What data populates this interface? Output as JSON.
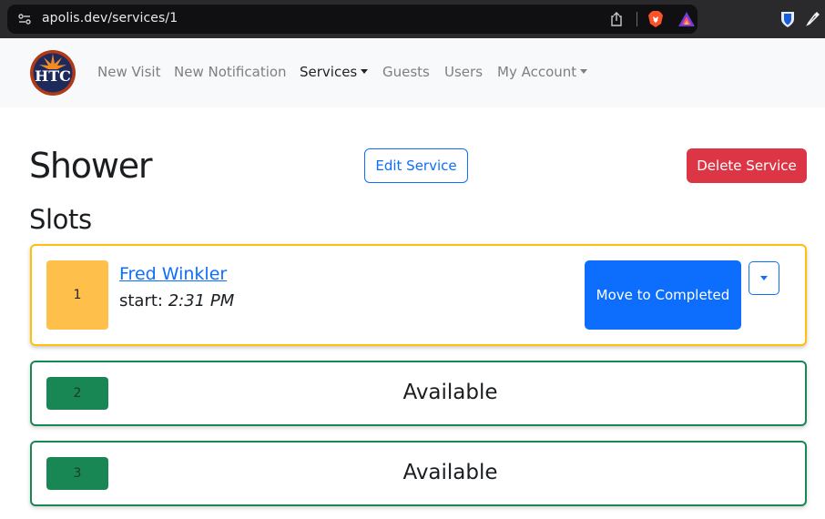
{
  "browser": {
    "url": "apolis.dev/services/1"
  },
  "nav": {
    "logo_text": "HTC",
    "items": [
      {
        "label": "New Visit",
        "has_dropdown": false,
        "active": false
      },
      {
        "label": "New Notification",
        "has_dropdown": false,
        "active": false
      },
      {
        "label": "Services",
        "has_dropdown": true,
        "active": true
      },
      {
        "label": "Guests",
        "has_dropdown": false,
        "active": false
      },
      {
        "label": "Users",
        "has_dropdown": false,
        "active": false
      },
      {
        "label": "My Account",
        "has_dropdown": true,
        "active": false
      }
    ]
  },
  "service": {
    "title": "Shower",
    "edit_label": "Edit Service",
    "delete_label": "Delete Service"
  },
  "slots_heading": "Slots",
  "slots": [
    {
      "number": "1",
      "status": "occupied",
      "guest_name": "Fred Winkler",
      "start_label": "start:",
      "start_time": "2:31 PM",
      "action_label": "Move to Completed"
    },
    {
      "number": "2",
      "status": "free",
      "label": "Available"
    },
    {
      "number": "3",
      "status": "free",
      "label": "Available"
    }
  ],
  "colors": {
    "primary": "#0d6efd",
    "danger": "#dc3545",
    "warning": "#ffc107",
    "success": "#198754"
  }
}
